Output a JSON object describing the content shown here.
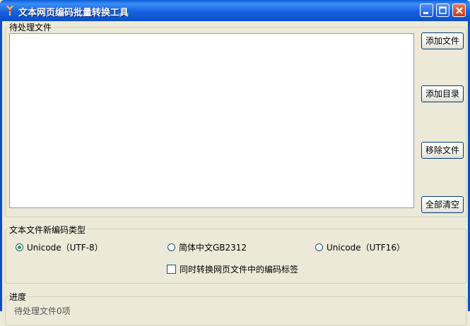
{
  "window": {
    "title": "文本网页编码批量转换工具",
    "titlebar_color": "#0a5fd8",
    "icons": [
      "app-icon",
      "minimize-icon",
      "maximize-icon",
      "close-icon"
    ]
  },
  "pending": {
    "legend": "待处理文件",
    "buttons": {
      "add_file": "添加文件",
      "add_dir": "添加目录",
      "remove_file": "移除文件",
      "clear_all": "全部清空"
    }
  },
  "encoding": {
    "legend": "文本文件新编码类型",
    "options": [
      {
        "label": "Unicode（UTF-8）",
        "selected": true
      },
      {
        "label": "简体中文GB2312",
        "selected": false
      },
      {
        "label": "Unicode（UTF16）",
        "selected": false
      }
    ],
    "convert_tags": {
      "label": "同时转换网页文件中的编码标签",
      "checked": false
    }
  },
  "progress": {
    "legend": "进度",
    "status": "待处理文件0项"
  }
}
